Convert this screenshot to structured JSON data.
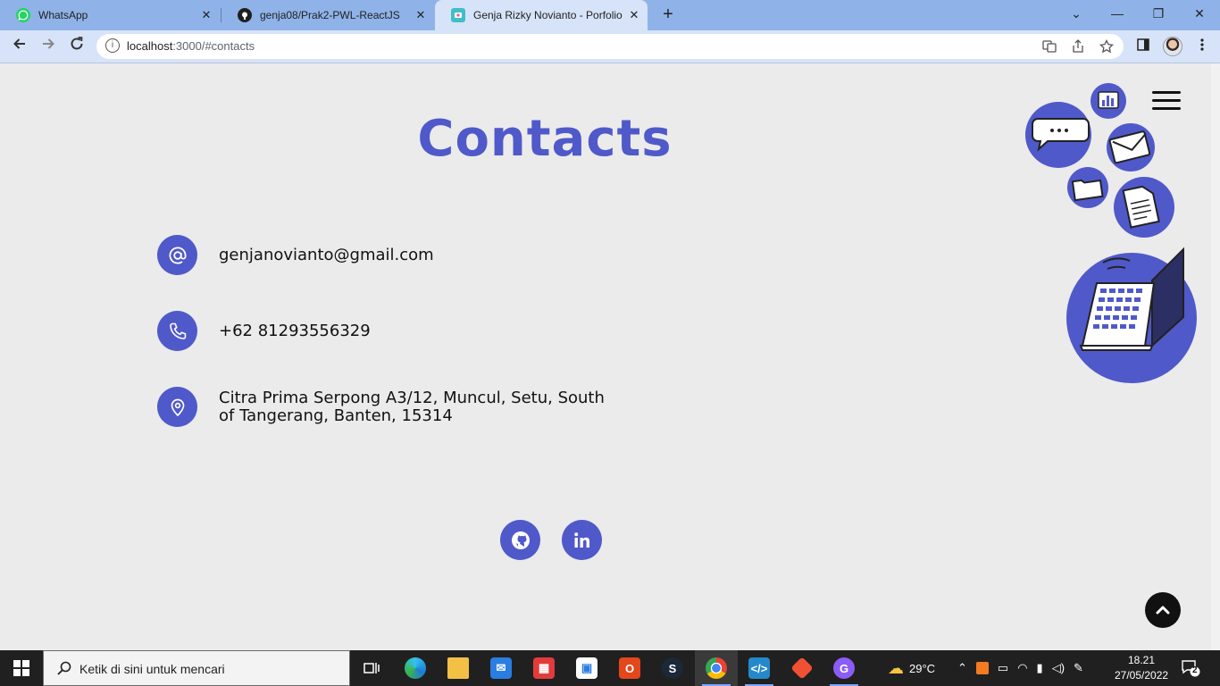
{
  "browser": {
    "tabs": [
      {
        "title": "WhatsApp",
        "icon": "whatsapp-icon"
      },
      {
        "title": "genja08/Prak2-PWL-ReactJS",
        "icon": "github-icon"
      },
      {
        "title": "Genja Rizky Novianto - Porfolio",
        "icon": "portfolio-icon",
        "active": true
      }
    ],
    "tab_close": "✕",
    "new_tab": "+",
    "window_controls": {
      "tab_search": "⌄",
      "minimize": "—",
      "restore": "❐",
      "close": "✕"
    },
    "url_host": "localhost",
    "url_rest": ":3000/#contacts"
  },
  "page": {
    "heading": "Contacts",
    "contacts": {
      "email": "genjanovianto@gmail.com",
      "phone": "+62 81293556329",
      "address": "Citra Prima Serpong A3/12, Muncul, Setu, South of Tangerang, Banten, 15314"
    },
    "social": [
      "github-icon",
      "linkedin-icon"
    ],
    "accent_color": "#5059c9"
  },
  "taskbar": {
    "search_placeholder": "Ketik di sini untuk mencari",
    "weather": "29°C",
    "time": "18.21",
    "date": "27/05/2022",
    "notification_count": "2"
  }
}
